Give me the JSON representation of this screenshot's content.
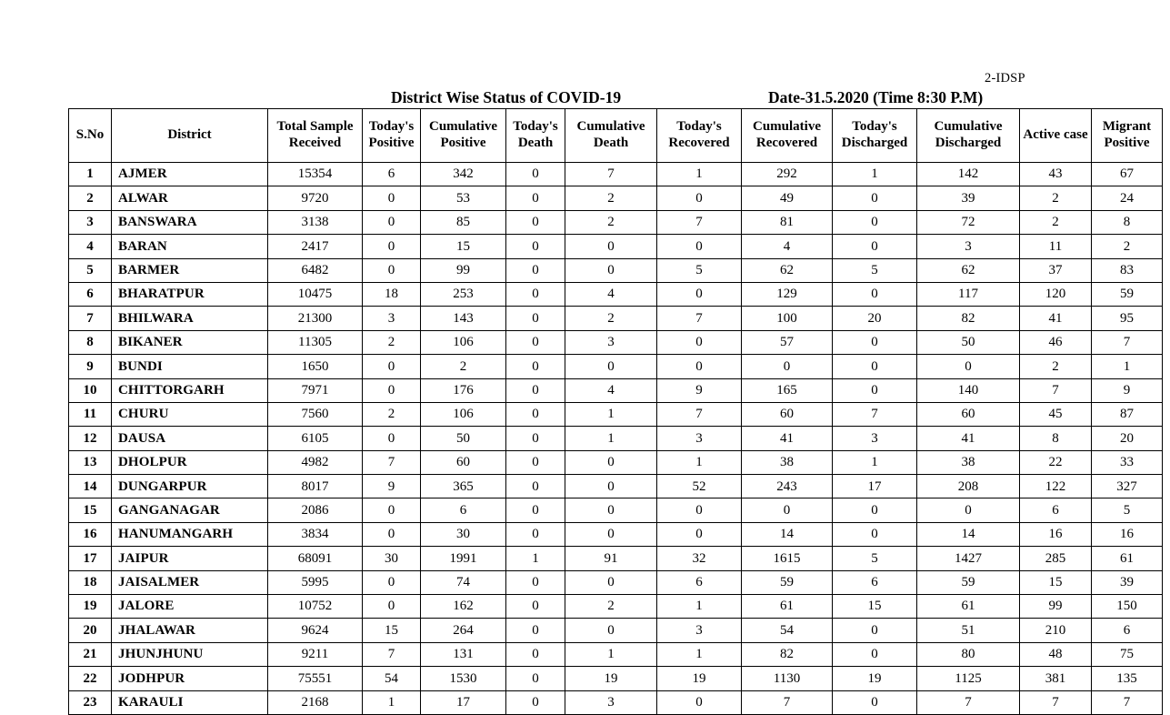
{
  "document": {
    "code": "2-IDSP",
    "title": "District Wise Status of  COVID-19",
    "date": "Date-31.5.2020 (Time 8:30 P.M)"
  },
  "table": {
    "columns": [
      {
        "key": "sno",
        "label": "S.No",
        "line1": "S.No",
        "line2": ""
      },
      {
        "key": "district",
        "label": "District",
        "line1": "District",
        "line2": ""
      },
      {
        "key": "total",
        "label": "Total Sample Received",
        "line1": "Total Sample",
        "line2": "Received"
      },
      {
        "key": "todpos",
        "label": "Today's Positive",
        "line1": "Today's",
        "line2": "Positive"
      },
      {
        "key": "cumpos",
        "label": "Cumulative Positive",
        "line1": "Cumulative",
        "line2": "Positive"
      },
      {
        "key": "toddeath",
        "label": "Today's Death",
        "line1": "Today's",
        "line2": "Death"
      },
      {
        "key": "cumdeath",
        "label": "Cumulative Death",
        "line1": "Cumulative",
        "line2": "Death"
      },
      {
        "key": "todrec",
        "label": "Today's Recovered",
        "line1": "Today's",
        "line2": "Recovered"
      },
      {
        "key": "cumrec",
        "label": "Cumulative Recovered",
        "line1": "Cumulative",
        "line2": "Recovered"
      },
      {
        "key": "toddis",
        "label": "Today's Discharged",
        "line1": "Today's",
        "line2": "Discharged"
      },
      {
        "key": "cumdis",
        "label": "Cumulative Discharged",
        "line1": "Cumulative",
        "line2": "Discharged"
      },
      {
        "key": "active",
        "label": "Active  case",
        "line1": "Active  case",
        "line2": ""
      },
      {
        "key": "migrant",
        "label": "Migrant Positive",
        "line1": "Migrant",
        "line2": "Positive"
      }
    ],
    "rows": [
      {
        "sno": "1",
        "district": "AJMER",
        "total": "15354",
        "todpos": "6",
        "cumpos": "342",
        "toddeath": "0",
        "cumdeath": "7",
        "todrec": "1",
        "cumrec": "292",
        "toddis": "1",
        "cumdis": "142",
        "active": "43",
        "migrant": "67"
      },
      {
        "sno": "2",
        "district": "ALWAR",
        "total": "9720",
        "todpos": "0",
        "cumpos": "53",
        "toddeath": "0",
        "cumdeath": "2",
        "todrec": "0",
        "cumrec": "49",
        "toddis": "0",
        "cumdis": "39",
        "active": "2",
        "migrant": "24"
      },
      {
        "sno": "3",
        "district": "BANSWARA",
        "total": "3138",
        "todpos": "0",
        "cumpos": "85",
        "toddeath": "0",
        "cumdeath": "2",
        "todrec": "7",
        "cumrec": "81",
        "toddis": "0",
        "cumdis": "72",
        "active": "2",
        "migrant": "8"
      },
      {
        "sno": "4",
        "district": "BARAN",
        "total": "2417",
        "todpos": "0",
        "cumpos": "15",
        "toddeath": "0",
        "cumdeath": "0",
        "todrec": "0",
        "cumrec": "4",
        "toddis": "0",
        "cumdis": "3",
        "active": "11",
        "migrant": "2"
      },
      {
        "sno": "5",
        "district": "BARMER",
        "total": "6482",
        "todpos": "0",
        "cumpos": "99",
        "toddeath": "0",
        "cumdeath": "0",
        "todrec": "5",
        "cumrec": "62",
        "toddis": "5",
        "cumdis": "62",
        "active": "37",
        "migrant": "83"
      },
      {
        "sno": "6",
        "district": "BHARATPUR",
        "total": "10475",
        "todpos": "18",
        "cumpos": "253",
        "toddeath": "0",
        "cumdeath": "4",
        "todrec": "0",
        "cumrec": "129",
        "toddis": "0",
        "cumdis": "117",
        "active": "120",
        "migrant": "59"
      },
      {
        "sno": "7",
        "district": "BHILWARA",
        "total": "21300",
        "todpos": "3",
        "cumpos": "143",
        "toddeath": "0",
        "cumdeath": "2",
        "todrec": "7",
        "cumrec": "100",
        "toddis": "20",
        "cumdis": "82",
        "active": "41",
        "migrant": "95"
      },
      {
        "sno": "8",
        "district": "BIKANER",
        "total": "11305",
        "todpos": "2",
        "cumpos": "106",
        "toddeath": "0",
        "cumdeath": "3",
        "todrec": "0",
        "cumrec": "57",
        "toddis": "0",
        "cumdis": "50",
        "active": "46",
        "migrant": "7"
      },
      {
        "sno": "9",
        "district": "BUNDI",
        "total": "1650",
        "todpos": "0",
        "cumpos": "2",
        "toddeath": "0",
        "cumdeath": "0",
        "todrec": "0",
        "cumrec": "0",
        "toddis": "0",
        "cumdis": "0",
        "active": "2",
        "migrant": "1"
      },
      {
        "sno": "10",
        "district": "CHITTORGARH",
        "total": "7971",
        "todpos": "0",
        "cumpos": "176",
        "toddeath": "0",
        "cumdeath": "4",
        "todrec": "9",
        "cumrec": "165",
        "toddis": "0",
        "cumdis": "140",
        "active": "7",
        "migrant": "9"
      },
      {
        "sno": "11",
        "district": "CHURU",
        "total": "7560",
        "todpos": "2",
        "cumpos": "106",
        "toddeath": "0",
        "cumdeath": "1",
        "todrec": "7",
        "cumrec": "60",
        "toddis": "7",
        "cumdis": "60",
        "active": "45",
        "migrant": "87"
      },
      {
        "sno": "12",
        "district": "DAUSA",
        "total": "6105",
        "todpos": "0",
        "cumpos": "50",
        "toddeath": "0",
        "cumdeath": "1",
        "todrec": "3",
        "cumrec": "41",
        "toddis": "3",
        "cumdis": "41",
        "active": "8",
        "migrant": "20"
      },
      {
        "sno": "13",
        "district": "DHOLPUR",
        "total": "4982",
        "todpos": "7",
        "cumpos": "60",
        "toddeath": "0",
        "cumdeath": "0",
        "todrec": "1",
        "cumrec": "38",
        "toddis": "1",
        "cumdis": "38",
        "active": "22",
        "migrant": "33"
      },
      {
        "sno": "14",
        "district": "DUNGARPUR",
        "total": "8017",
        "todpos": "9",
        "cumpos": "365",
        "toddeath": "0",
        "cumdeath": "0",
        "todrec": "52",
        "cumrec": "243",
        "toddis": "17",
        "cumdis": "208",
        "active": "122",
        "migrant": "327"
      },
      {
        "sno": "15",
        "district": "GANGANAGAR",
        "total": "2086",
        "todpos": "0",
        "cumpos": "6",
        "toddeath": "0",
        "cumdeath": "0",
        "todrec": "0",
        "cumrec": "0",
        "toddis": "0",
        "cumdis": "0",
        "active": "6",
        "migrant": "5"
      },
      {
        "sno": "16",
        "district": "HANUMANGARH",
        "total": "3834",
        "todpos": "0",
        "cumpos": "30",
        "toddeath": "0",
        "cumdeath": "0",
        "todrec": "0",
        "cumrec": "14",
        "toddis": "0",
        "cumdis": "14",
        "active": "16",
        "migrant": "16"
      },
      {
        "sno": "17",
        "district": "JAIPUR",
        "total": "68091",
        "todpos": "30",
        "cumpos": "1991",
        "toddeath": "1",
        "cumdeath": "91",
        "todrec": "32",
        "cumrec": "1615",
        "toddis": "5",
        "cumdis": "1427",
        "active": "285",
        "migrant": "61"
      },
      {
        "sno": "18",
        "district": "JAISALMER",
        "total": "5995",
        "todpos": "0",
        "cumpos": "74",
        "toddeath": "0",
        "cumdeath": "0",
        "todrec": "6",
        "cumrec": "59",
        "toddis": "6",
        "cumdis": "59",
        "active": "15",
        "migrant": "39"
      },
      {
        "sno": "19",
        "district": "JALORE",
        "total": "10752",
        "todpos": "0",
        "cumpos": "162",
        "toddeath": "0",
        "cumdeath": "2",
        "todrec": "1",
        "cumrec": "61",
        "toddis": "15",
        "cumdis": "61",
        "active": "99",
        "migrant": "150"
      },
      {
        "sno": "20",
        "district": "JHALAWAR",
        "total": "9624",
        "todpos": "15",
        "cumpos": "264",
        "toddeath": "0",
        "cumdeath": "0",
        "todrec": "3",
        "cumrec": "54",
        "toddis": "0",
        "cumdis": "51",
        "active": "210",
        "migrant": "6"
      },
      {
        "sno": "21",
        "district": "JHUNJHUNU",
        "total": "9211",
        "todpos": "7",
        "cumpos": "131",
        "toddeath": "0",
        "cumdeath": "1",
        "todrec": "1",
        "cumrec": "82",
        "toddis": "0",
        "cumdis": "80",
        "active": "48",
        "migrant": "75"
      },
      {
        "sno": "22",
        "district": "JODHPUR",
        "total": "75551",
        "todpos": "54",
        "cumpos": "1530",
        "toddeath": "0",
        "cumdeath": "19",
        "todrec": "19",
        "cumrec": "1130",
        "toddis": "19",
        "cumdis": "1125",
        "active": "381",
        "migrant": "135"
      },
      {
        "sno": "23",
        "district": "KARAULI",
        "total": "2168",
        "todpos": "1",
        "cumpos": "17",
        "toddeath": "0",
        "cumdeath": "3",
        "todrec": "0",
        "cumrec": "7",
        "toddis": "0",
        "cumdis": "7",
        "active": "7",
        "migrant": "7"
      }
    ]
  }
}
